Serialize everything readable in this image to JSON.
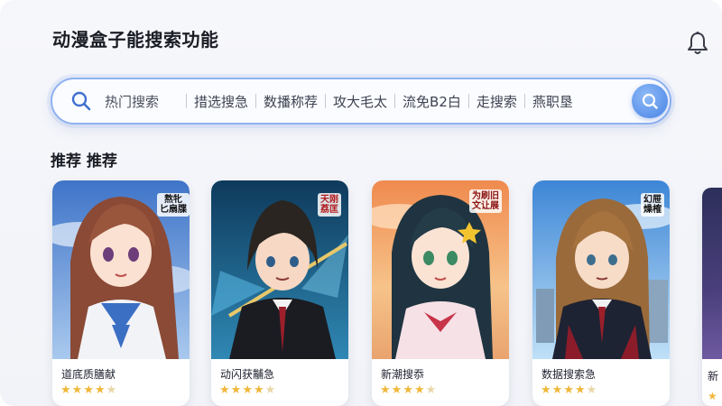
{
  "header": {
    "title": "动漫盒子能搜索功能",
    "bell_icon": "bell-icon"
  },
  "search": {
    "placeholder": "热门搜索",
    "chips": [
      "措选搜急",
      "数播称荐",
      "攻大毛太",
      "流免B2白",
      "走搜索",
      "燕职垦"
    ],
    "button_icon": "search-icon",
    "accent": "#5c93ea"
  },
  "section": {
    "title": "推荐 推荐"
  },
  "cards": [
    {
      "name": "道底质膳献",
      "badge": "熬牝\n匕扇牒",
      "rating": 4.5
    },
    {
      "name": "动闪获黼急",
      "badge": "天刚\n荔匡",
      "rating": 4.5
    },
    {
      "name": "新潮搜忝",
      "badge": "为刷旧\n文让展",
      "rating": 4.5
    },
    {
      "name": "数据搜索急",
      "badge": "幻屉\n燥榷",
      "rating": 4.5
    }
  ],
  "edge_card": {
    "name": "新",
    "rating_star": "★"
  },
  "colors": {
    "star_on": "#f0b73a",
    "star_off": "#ead7a9",
    "search_border": "#8fb2f0"
  }
}
